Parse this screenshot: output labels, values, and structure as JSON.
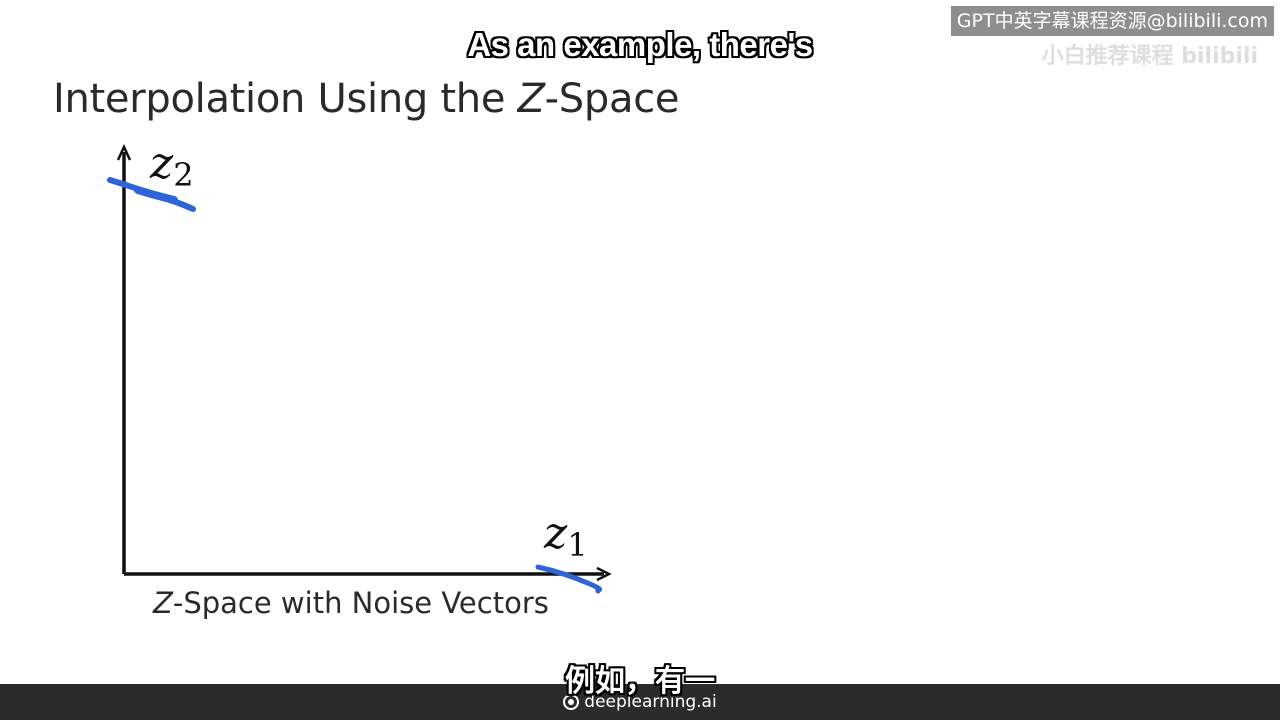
{
  "watermark": {
    "text": "GPT中英字幕课程资源@bilibili.com",
    "ghost_text": "小白推荐课程 bilibili"
  },
  "subtitles": {
    "english": "As an example, there's",
    "chinese": "例如，有一"
  },
  "slide": {
    "title_prefix": "Interpolation Using the ",
    "title_italic": "Z",
    "title_suffix": "-Space",
    "caption_italic": "Z",
    "caption_rest": "-Space with Noise Vectors"
  },
  "diagram": {
    "y_axis": {
      "label_var": "z",
      "label_sub": "2"
    },
    "x_axis": {
      "label_var": "z",
      "label_sub": "1"
    },
    "annotation_color": "#2f63d8",
    "axis_color": "#111111"
  },
  "footer": {
    "brand": "deeplearning.ai"
  }
}
